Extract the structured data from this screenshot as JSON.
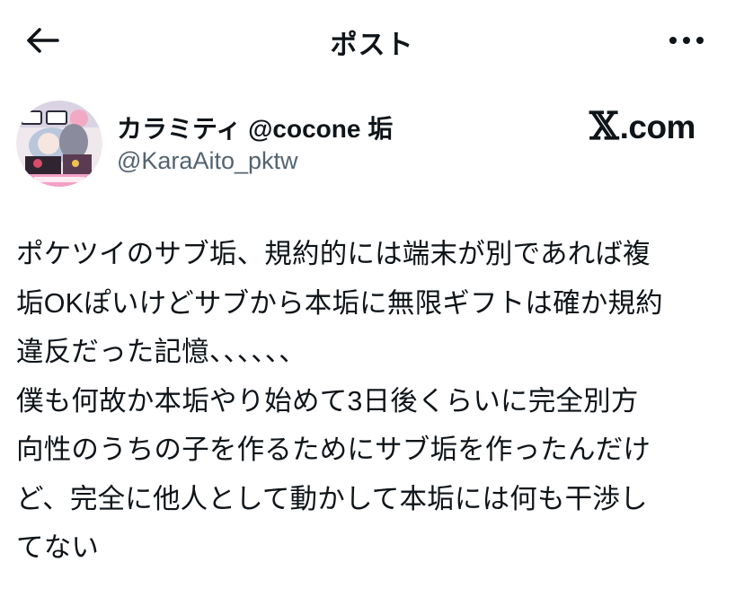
{
  "header": {
    "back_icon": "arrow-left-icon",
    "title": "ポスト",
    "more_icon": "more-horizontal-icon"
  },
  "author": {
    "display_name": "カラミティ @cocone 垢",
    "handle": "@KaraAito_pktw",
    "avatar": "user-avatar"
  },
  "brand": {
    "x_glyph": "𝕏",
    "text": ".com"
  },
  "post": {
    "lines": [
      "ポケツイのサブ垢、規約的には端末が別であれば複",
      "垢OKぽいけどサブから本垢に無限ギフトは確か規約",
      "違反だった記憶、、、、、、",
      "僕も何故か本垢やり始めて3日後くらいに完全別方",
      "向性のうちの子を作るためにサブ垢を作ったんだけ",
      "ど、完全に他人として動かして本垢には何も干渉し",
      "てない"
    ]
  },
  "colors": {
    "text": "#0f1419",
    "secondary": "#536471",
    "background": "#ffffff"
  }
}
